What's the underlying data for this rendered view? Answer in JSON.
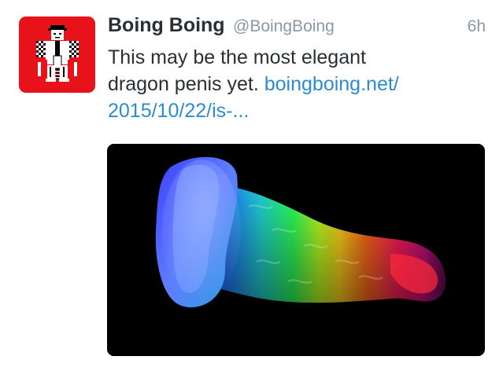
{
  "tweet": {
    "author": {
      "name": "Boing Boing",
      "handle": "@BoingBoing",
      "avatar_icon": "boing-boing-jetpack-logo",
      "avatar_bg": "#e8121b"
    },
    "timestamp": "6h",
    "text_line1": "This may be the most elegant",
    "text_line2_prefix": "dragon penis yet.",
    "link_part1": "boingboing.net/",
    "link_part2": "2015/10/22/is-...",
    "link_color": "#2b8cd1",
    "media": {
      "description_icon": "rainbow-glow-object-image",
      "background": "#000000"
    }
  }
}
